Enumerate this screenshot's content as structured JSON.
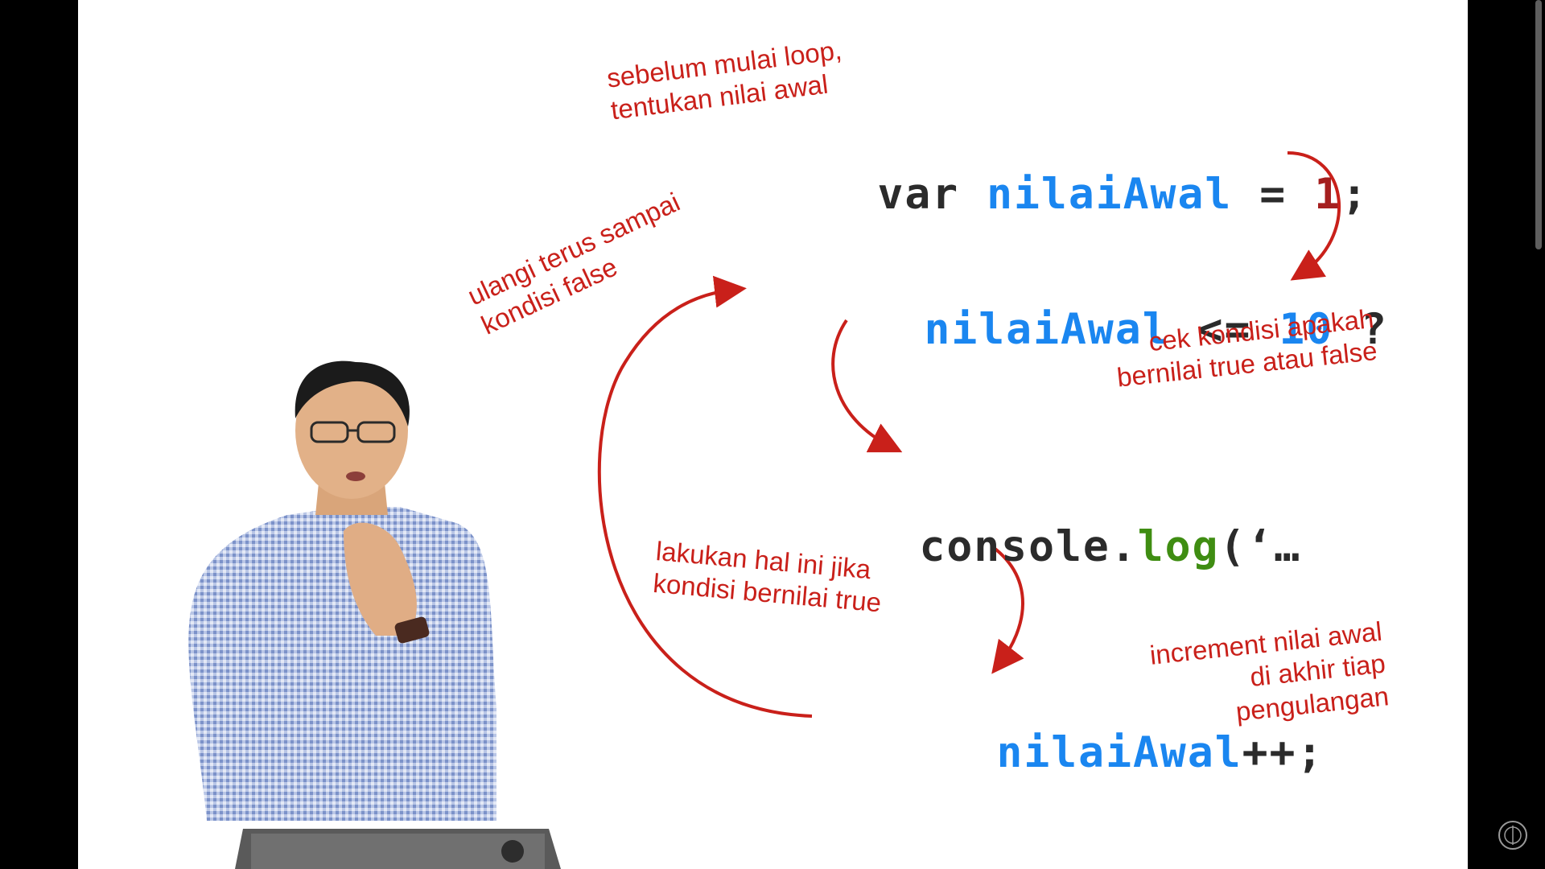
{
  "slide": {
    "code": {
      "line1": {
        "kw": "var",
        "var": "nilaiAwal",
        "op": "=",
        "num": "1",
        "end": ";"
      },
      "line2": {
        "var": "nilaiAwal",
        "op": "<=",
        "num": "10",
        "end": "?"
      },
      "line3": {
        "obj": "console.",
        "fn": "log",
        "rest": "(‘…"
      },
      "line4": {
        "var": "nilaiAwal",
        "rest": "++;"
      }
    },
    "notes": {
      "init": "sebelum mulai loop,\ntentukan nilai awal",
      "repeat": "ulangi terus sampai\nkondisi false",
      "check": "cek kondisi apakah\nbernilai true atau false",
      "body": "lakukan hal ini jika\nkondisi bernilai true",
      "increment": "increment nilai awal\ndi akhir tiap\npengulangan"
    },
    "colors": {
      "keyword": "#2b2b2b",
      "variable": "#1a86f0",
      "number": "#a51f1f",
      "method": "#3f8d12",
      "annotation": "#c9201a"
    }
  },
  "overlay": {
    "presenter": "presenter-video",
    "logo_icon": "lock-badge-icon"
  }
}
